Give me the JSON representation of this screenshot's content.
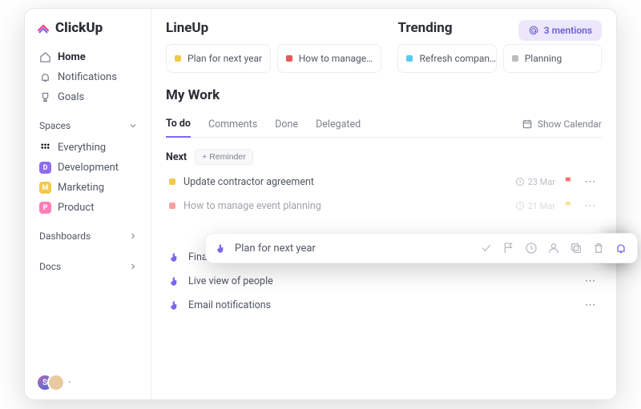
{
  "brand": {
    "name": "ClickUp"
  },
  "sidebar": {
    "nav": [
      {
        "label": "Home",
        "active": true
      },
      {
        "label": "Notifications",
        "active": false
      },
      {
        "label": "Goals",
        "active": false
      }
    ],
    "spaces_label": "Spaces",
    "everything_label": "Everything",
    "spaces": [
      {
        "letter": "D",
        "label": "Development",
        "color": "#8e6cef"
      },
      {
        "letter": "M",
        "label": "Marketing",
        "color": "#f2c94c"
      },
      {
        "letter": "P",
        "label": "Product",
        "color": "#ff7eb6"
      }
    ],
    "dashboards_label": "Dashboards",
    "docs_label": "Docs",
    "avatar_initial": "S"
  },
  "top": {
    "lineup_heading": "LineUp",
    "trending_heading": "Trending",
    "mentions_label": "3 mentions",
    "lineup_cards": [
      {
        "label": "Plan for next year",
        "dot": "yellow"
      },
      {
        "label": "How to manage…",
        "dot": "red"
      }
    ],
    "trending_cards": [
      {
        "label": "Refresh compan…",
        "dot": "cyan"
      },
      {
        "label": "Planning",
        "dot": "gray"
      }
    ]
  },
  "mywork": {
    "heading": "My Work",
    "tabs": [
      {
        "label": "To do",
        "active": true
      },
      {
        "label": "Comments",
        "active": false
      },
      {
        "label": "Done",
        "active": false
      },
      {
        "label": "Delegated",
        "active": false
      }
    ],
    "show_calendar_label": "Show Calendar",
    "next_label": "Next",
    "reminder_label": "+ Reminder",
    "tasks_top": [
      {
        "label": "Update contractor agreement",
        "dot": "yellow",
        "date": "23 Mar",
        "flag_color": "#ff6b6b"
      },
      {
        "label": "How to manage event planning",
        "dot": "red",
        "date": "21 Mar",
        "flag_color": "#f2c94c"
      }
    ],
    "tasks_bottom": [
      {
        "label": "Finalize project scope"
      },
      {
        "label": "Live view of people"
      },
      {
        "label": "Email notifications"
      }
    ]
  },
  "popover": {
    "title": "Plan for next year",
    "actions": [
      "check",
      "flag",
      "clock",
      "user",
      "copy",
      "trash",
      "bell"
    ]
  }
}
